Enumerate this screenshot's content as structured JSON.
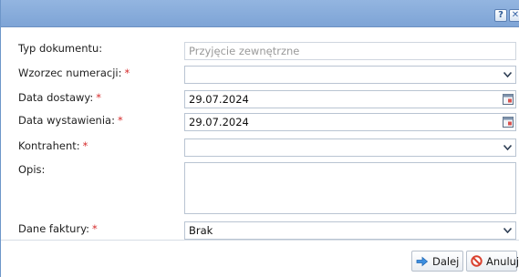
{
  "dialog": {
    "help_label": "?",
    "close_label": "✕"
  },
  "form": {
    "typ_dokumentu": {
      "label": "Typ dokumentu:",
      "value": "Przyjęcie zewnętrzne",
      "required": false
    },
    "wzorzec_numeracji": {
      "label": "Wzorzec numeracji:",
      "value": "",
      "required": true
    },
    "data_dostawy": {
      "label": "Data dostawy:",
      "value": "29.07.2024",
      "required": true
    },
    "data_wystawienia": {
      "label": "Data wystawienia:",
      "value": "29.07.2024",
      "required": true
    },
    "kontrahent": {
      "label": "Kontrahent:",
      "value": "",
      "required": true
    },
    "opis": {
      "label": "Opis:",
      "value": "",
      "required": false
    },
    "dane_faktury": {
      "label": "Dane faktury:",
      "value": "Brak",
      "required": true
    },
    "required_mark": "*"
  },
  "footer": {
    "next_label": "Dalej",
    "cancel_label": "Anuluj"
  },
  "icons": {
    "help": "help-icon",
    "close": "close-icon",
    "dropdown": "chevron-down-icon",
    "calendar": "calendar-icon",
    "next": "arrow-right-icon",
    "cancel": "cancel-icon"
  }
}
